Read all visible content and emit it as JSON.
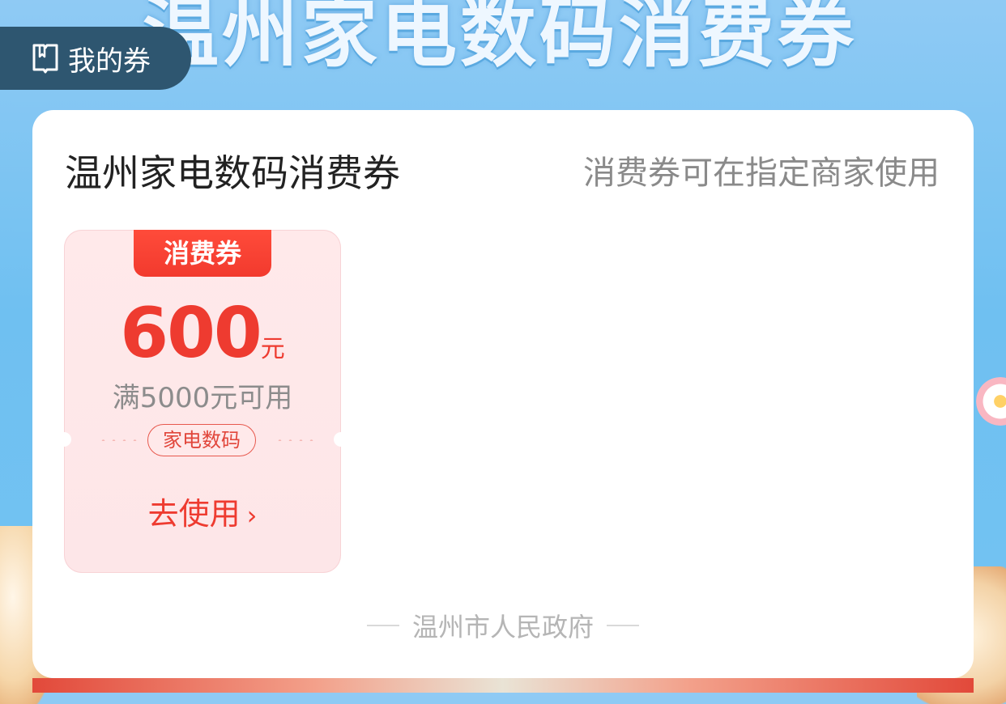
{
  "banner": {
    "title": "温州家电数码消费券"
  },
  "header": {
    "my_coupons_label": "我的券"
  },
  "card": {
    "title": "温州家电数码消费券",
    "hint": "消费券可在指定商家使用",
    "coupon": {
      "tag": "消费券",
      "amount": "600",
      "unit": "元",
      "condition": "满5000元可用",
      "category": "家电数码",
      "action_label": "去使用"
    },
    "issuer": "温州市人民政府"
  },
  "colors": {
    "accent_red": "#ee3b30",
    "header_pill": "#2e5670",
    "background_sky": "#6fc0f1"
  },
  "icons": {
    "my_coupons": "coupon-book-icon",
    "action": "chevron-right-icon"
  }
}
